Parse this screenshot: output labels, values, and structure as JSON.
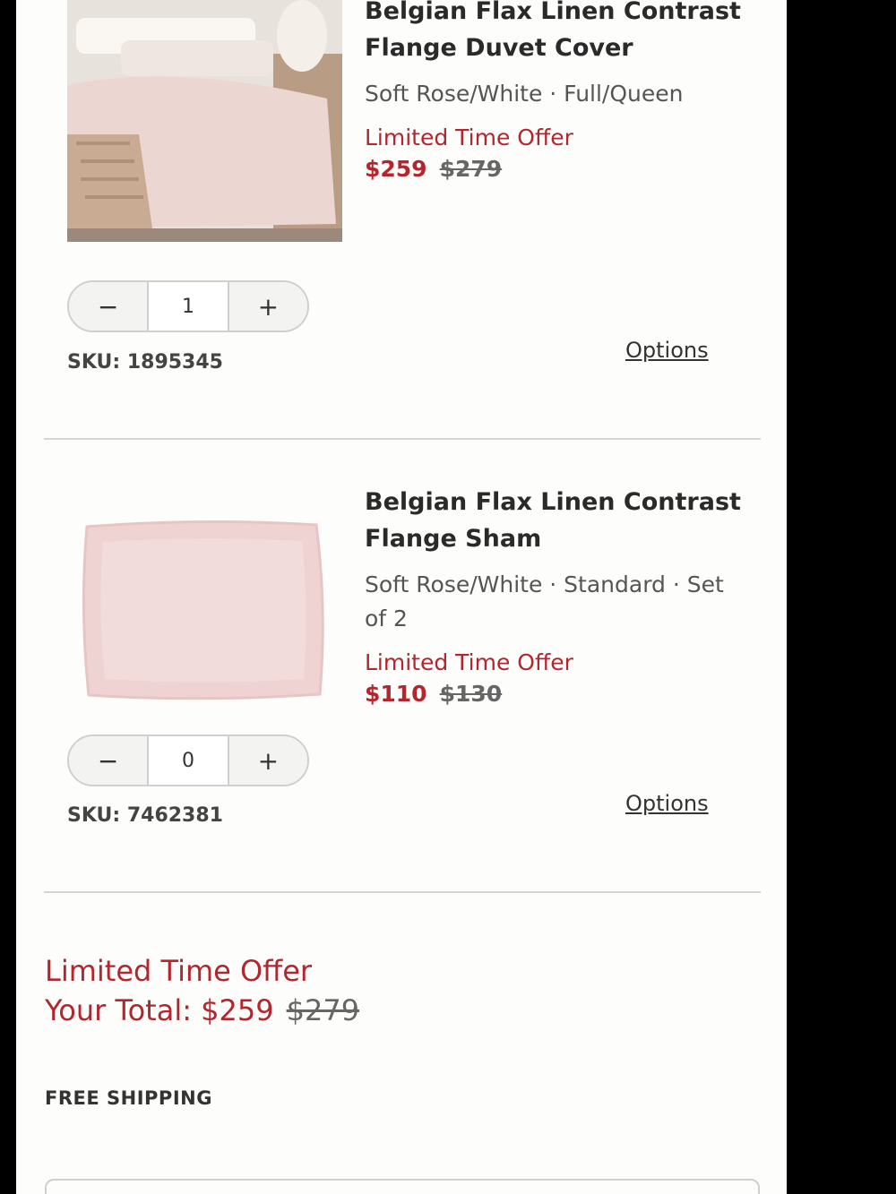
{
  "items": [
    {
      "title": "Belgian Flax Linen Contrast Flange Duvet Cover",
      "variant": "Soft Rose/White · Full/Queen",
      "offer_label": "Limited Time Offer",
      "price_now": "$259",
      "price_was": "$279",
      "quantity": "1",
      "sku": "SKU: 1895345",
      "options_label": "Options",
      "image_icon": "duvet-bed-image"
    },
    {
      "title": "Belgian Flax Linen Contrast Flange Sham",
      "variant": "Soft Rose/White · Standard · Set of 2",
      "offer_label": "Limited Time Offer",
      "price_now": "$110",
      "price_was": "$130",
      "quantity": "0",
      "sku": "SKU: 7462381",
      "options_label": "Options",
      "image_icon": "pillow-sham-image"
    }
  ],
  "stepper": {
    "minus": "−",
    "plus": "+"
  },
  "summary": {
    "offer_label": "Limited Time Offer",
    "total_label": "Your Total: $259",
    "total_was": "$279",
    "shipping": "FREE SHIPPING"
  },
  "colors": {
    "accent_red": "#b3262d",
    "text": "#2a2a2a",
    "divider": "#d6d6d6"
  }
}
